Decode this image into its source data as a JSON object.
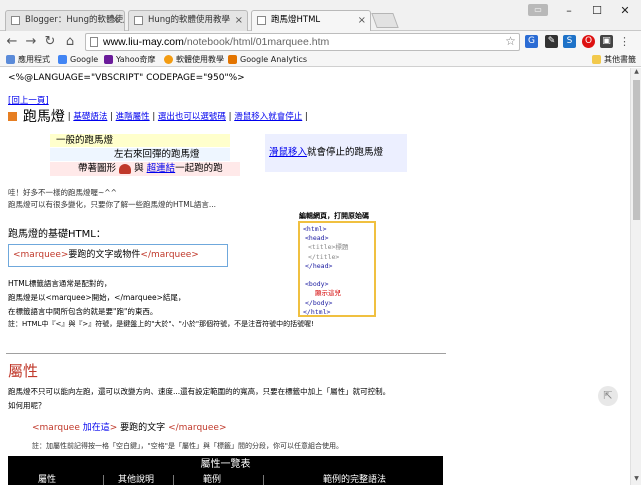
{
  "browser": {
    "tabs": [
      {
        "label": "Blogger：Hung的軟體使用",
        "active": false
      },
      {
        "label": "Hung的軟體使用教學",
        "active": false
      },
      {
        "label": "跑馬燈HTML",
        "active": true
      }
    ],
    "url_host": "www.liu-may.com",
    "url_path": "/notebook/html/01marquee.htm",
    "bookmarks": [
      "應用程式",
      "Google",
      "Yahoo奇摩",
      "軟體使用教學",
      "Google Analytics"
    ],
    "other_bookmarks": "其他書籤"
  },
  "page": {
    "asp_directive": "<%@LANGUAGE=\"VBSCRIPT\" CODEPAGE=\"950\"%>",
    "back_link": "[回上一頁]",
    "title": "跑馬燈",
    "nav_links": [
      "基礎語法",
      "進階屬性",
      "選出也可以選號碼",
      "滑鼠移入就會停止"
    ],
    "demo1": "一般的跑馬燈",
    "demo2": "左右來回彈的跑馬燈",
    "demo3_a": "帶著圖形",
    "demo3_b": "與",
    "demo3_link": "超連結",
    "demo3_c": "一起跑的跑",
    "hover_link": "滑鼠移入",
    "hover_text": "就會停止的跑馬燈",
    "intro1": "哇！好多不一樣的跑馬燈喔~^^",
    "intro2": "跑馬燈可以有很多變化，只要你了解一些跑馬燈的HTML語言...",
    "source_title": "編輯網頁，打開原始碼",
    "source_lines": [
      "<html>",
      "<head>",
      "<title>標題</title>",
      "</head>",
      "",
      "<body>",
      "顯示這兒",
      "</body>",
      "</html>"
    ],
    "basic_heading": "跑馬燈的基礎HTML：",
    "code_open": "<marquee>",
    "code_text": "要跑的文字或物件",
    "code_close": "</marquee>",
    "para1": "HTML標籤語言通常是配對的，",
    "para2": "跑馬燈是以<marquee>開始，</marquee>結尾，",
    "para3": "在標籤語言中間所包含的就是要\"跑\"的東西。",
    "para4": "註：HTML中『<』與『>』符號，是鍵盤上的\"大於\"、\"小於\"那個符號，不是注音符號中的括號喔!",
    "attr_heading": "屬性",
    "attr_para1": "跑馬燈不只可以能向左跑，還可以改變方向、速度...還有設定範圍的的寬高，只要在標籤中加上「屬性」就可控制。",
    "attr_para2": "如何用呢？",
    "attr_code_open": "<marquee",
    "attr_code_here": "加在這",
    "attr_code_gt": ">",
    "attr_code_text": "要跑的文字",
    "attr_code_close": "</marquee>",
    "attr_note": "註：加屬性前記得按一格「空白鍵」，\"空格\"是「屬性」與「標籤」間的分段，你可以任意組合使用。",
    "table_title": "屬性一覽表",
    "table_headers": [
      "屬性",
      "其他說明",
      "範例",
      "範例的完整語法"
    ]
  }
}
